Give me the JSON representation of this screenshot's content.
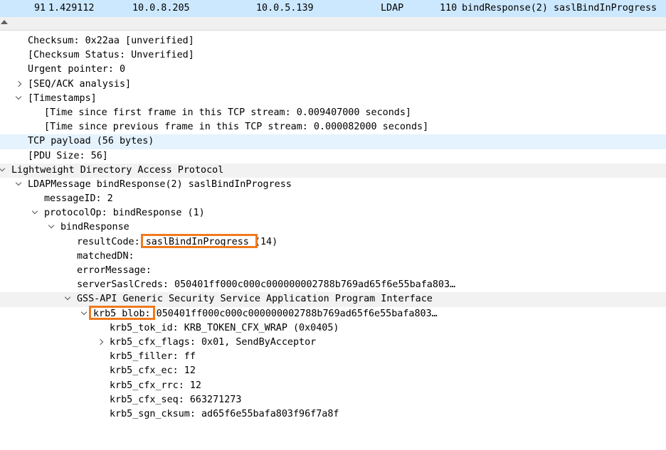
{
  "packet": {
    "no": "91",
    "time": "1.429112",
    "source": "10.0.8.205",
    "destination": "10.0.5.139",
    "protocol": "LDAP",
    "length": "110",
    "info": "bindResponse(2) saslBindInProgress"
  },
  "tree": {
    "checksum": "Checksum: 0x22aa [unverified]",
    "checksum_status": "[Checksum Status: Unverified]",
    "urgent": "Urgent pointer: 0",
    "seq_ack": "[SEQ/ACK analysis]",
    "timestamps": "[Timestamps]",
    "time_first": "[Time since first frame in this TCP stream: 0.009407000 seconds]",
    "time_prev": "[Time since previous frame in this TCP stream: 0.000082000 seconds]",
    "tcp_payload": "TCP payload (56 bytes)",
    "pdu_size": "[PDU Size: 56]",
    "ldap": "Lightweight Directory Access Protocol",
    "ldap_message": "LDAPMessage bindResponse(2) saslBindInProgress",
    "message_id": "messageID: 2",
    "protocol_op": "protocolOp: bindResponse (1)",
    "bind_response": "bindResponse",
    "result_code_label": "resultCode: ",
    "result_code_value": "saslBindInProgress",
    "result_code_num": " (14)",
    "matched_dn": "matchedDN:",
    "error_message": "errorMessage:",
    "server_sasl_creds": "serverSaslCreds: 050401ff000c000c000000002788b769ad65f6e55bafa803…",
    "gss_api": "GSS-API Generic Security Service Application Program Interface",
    "krb5_blob_label": "krb5_blob:",
    "krb5_blob_value": " 050401ff000c000c000000002788b769ad65f6e55bafa803…",
    "tok_id": "krb5_tok_id: KRB_TOKEN_CFX_WRAP (0x0405)",
    "cfx_flags": "krb5_cfx_flags: 0x01, SendByAcceptor",
    "filler": "krb5_filler: ff",
    "cfx_ec": "krb5_cfx_ec: 12",
    "cfx_rrc": "krb5_cfx_rrc: 12",
    "cfx_seq": "krb5_cfx_seq: 663271273",
    "sgn_cksum": "krb5_sgn_cksum: ad65f6e55bafa803f96f7a8f"
  },
  "colors": {
    "selected_packet": "#cce8ff",
    "highlight_box": "#f07a1f"
  }
}
